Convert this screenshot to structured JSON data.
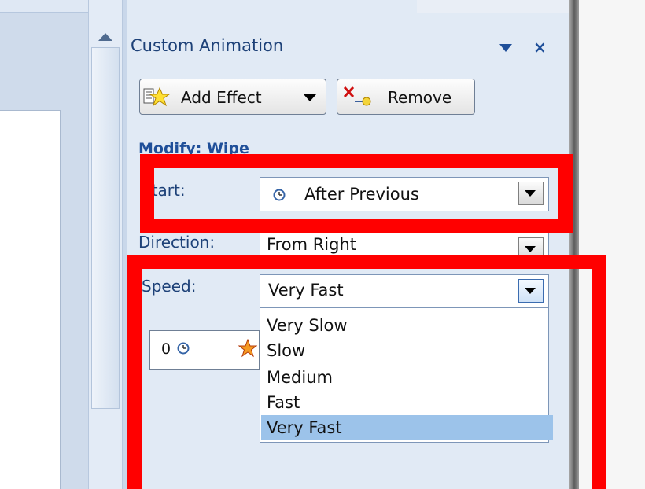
{
  "pane": {
    "title": "Custom Animation"
  },
  "toolbar": {
    "add_effect_label": "Add Effect",
    "remove_label": "Remove"
  },
  "modify": {
    "label": "Modify: Wipe"
  },
  "fields": {
    "start": {
      "label": "Start:",
      "value": "After Previous"
    },
    "direction": {
      "label": "Direction:",
      "value": "From Right"
    },
    "speed": {
      "label": "Speed:",
      "value": "Very Fast",
      "options": [
        "Very Slow",
        "Slow",
        "Medium",
        "Fast",
        "Very Fast"
      ],
      "selected_index": 4
    }
  },
  "animation_list": {
    "items": [
      {
        "order": "0"
      }
    ]
  },
  "icons": {
    "add_effect": "star-effect-icon",
    "remove": "remove-effect-icon",
    "clock": "clock-icon",
    "pane_menu": "triangle-down-icon",
    "pane_close": "close-icon",
    "effect_star": "effect-star-icon"
  },
  "colors": {
    "highlight_box": "#ff0000",
    "selected_option": "#9cc3ea",
    "pane_background": "#e1eaf5",
    "title_text": "#1d4178"
  }
}
